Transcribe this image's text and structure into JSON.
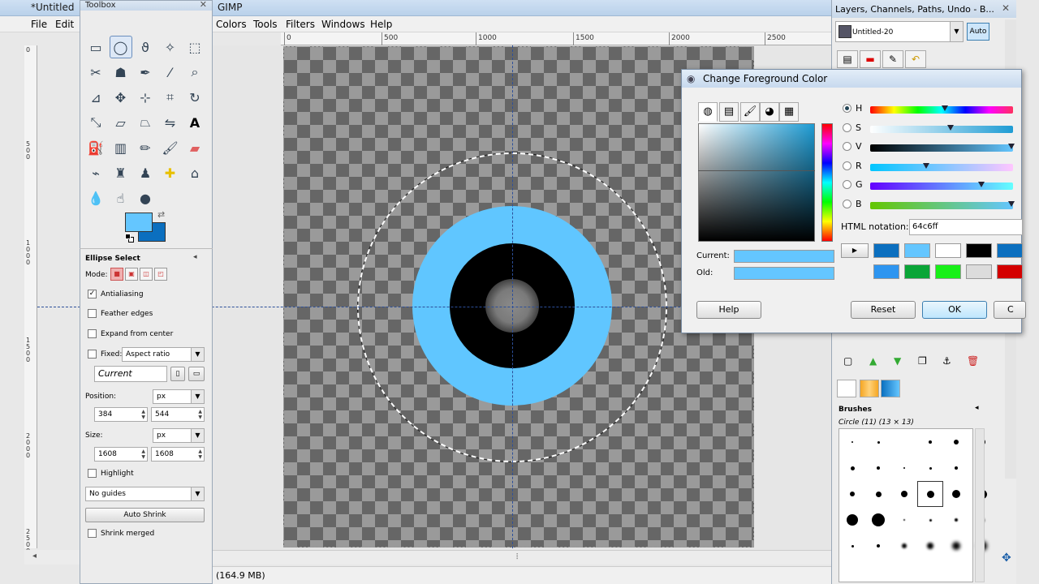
{
  "window": {
    "title_prefix": "*Untitled",
    "title_suffix": "GIMP"
  },
  "menubar": [
    "File",
    "Edit",
    "Colors",
    "Tools",
    "Filters",
    "Windows",
    "Help"
  ],
  "ruler": {
    "h_ticks": [
      "0",
      "500",
      "1000",
      "1500",
      "2000",
      "2500"
    ],
    "v_ticks": [
      "0",
      "500",
      "1000",
      "1500",
      "2000",
      "2500"
    ]
  },
  "status": {
    "memory": "(164.9 MB)"
  },
  "toolbox": {
    "title": "Toolbox",
    "tool_icons": [
      "rect-select-icon",
      "ellipse-select-icon",
      "lasso-icon",
      "fuzzy-select-icon",
      "by-color-select-icon",
      "scissors-icon",
      "foreground-select-icon",
      "paths-icon",
      "color-picker-icon",
      "zoom-icon",
      "measure-icon",
      "move-icon",
      "align-icon",
      "crop-icon",
      "rotate-icon",
      "scale-icon",
      "shear-icon",
      "perspective-icon",
      "flip-icon",
      "text-icon",
      "bucket-fill-icon",
      "blend-icon",
      "pencil-icon",
      "paintbrush-icon",
      "eraser-icon",
      "airbrush-icon",
      "ink-icon",
      "clone-icon",
      "heal-icon",
      "perspective-clone-icon",
      "blur-icon",
      "smudge-icon",
      "dodge-burn-icon"
    ],
    "fg_color": "#64c6ff",
    "bg_color": "#0b6fbf"
  },
  "options": {
    "title": "Ellipse Select",
    "mode_label": "Mode:",
    "antialiasing": "Antialiasing",
    "feather": "Feather edges",
    "expand": "Expand from center",
    "fixed": "Fixed:",
    "fixed_value": "Aspect ratio",
    "current": "Current",
    "position_label": "Position:",
    "position_unit": "px",
    "pos_x": "384",
    "pos_y": "544",
    "size_label": "Size:",
    "size_unit": "px",
    "size_w": "1608",
    "size_h": "1608",
    "highlight": "Highlight",
    "guides": "No guides",
    "auto_shrink": "Auto Shrink",
    "shrink_merged": "Shrink merged"
  },
  "dialog": {
    "title": "Change Foreground Color",
    "sliders": [
      {
        "label": "H",
        "thumb": 0.52,
        "selected": true
      },
      {
        "label": "S",
        "thumb": 0.56,
        "selected": false
      },
      {
        "label": "V",
        "thumb": 1.0,
        "selected": false
      },
      {
        "label": "R",
        "thumb": 0.38,
        "selected": false
      },
      {
        "label": "G",
        "thumb": 0.78,
        "selected": false
      },
      {
        "label": "B",
        "thumb": 1.0,
        "selected": false
      }
    ],
    "html_label": "HTML notation:",
    "html_value": "64c6ff",
    "current_label": "Current:",
    "old_label": "Old:",
    "history": [
      "#0b6fbf",
      "#64c6ff",
      "#ffffff",
      "#000000",
      "#0b6fbf",
      "#2d95f0",
      "#0aa537",
      "#18f018",
      "#dcdcdc",
      "#d40000"
    ],
    "help": "Help",
    "reset": "Reset",
    "ok": "OK",
    "cancel": "C"
  },
  "dock": {
    "title": "Layers, Channels, Paths, Undo - B...",
    "image": "Untitled-20",
    "auto": "Auto",
    "brushes_title": "Brushes",
    "brush_name": "Circle (11) (13 × 13)"
  }
}
